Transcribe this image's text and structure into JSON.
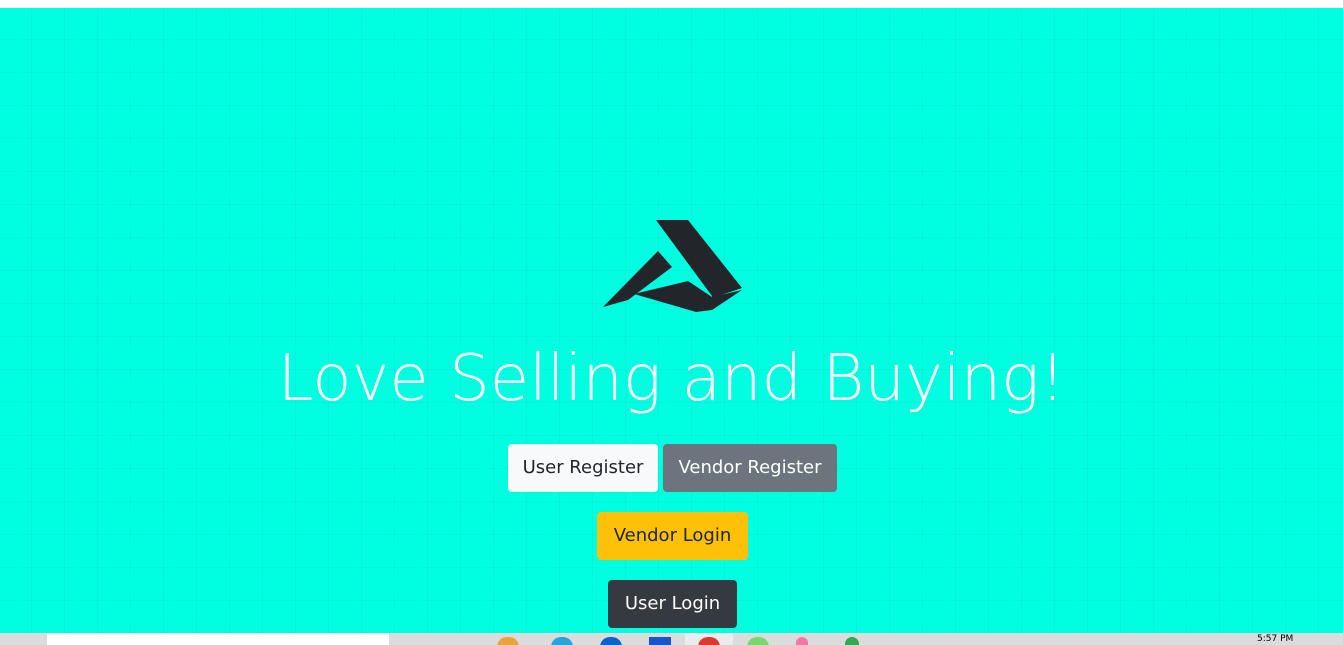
{
  "hero": {
    "headline": "Love Selling and Buying!",
    "background_color": "#00ffe1",
    "logo_icon": "brand-logo-icon"
  },
  "buttons": {
    "user_register": "User Register",
    "vendor_register": "Vendor Register",
    "vendor_login": "Vendor Login",
    "user_login": "User Login"
  },
  "taskbar": {
    "clock": "5:57 PM",
    "icons": [
      "app-icon-orange",
      "edge-icon",
      "dropbox-icon",
      "store-icon",
      "chrome-icon",
      "whatsapp-icon",
      "app-icon-pink",
      "app-icon-green"
    ]
  },
  "colors": {
    "light": "#f8f9fa",
    "secondary": "#6c757d",
    "warning": "#ffc107",
    "dark": "#343a40"
  }
}
